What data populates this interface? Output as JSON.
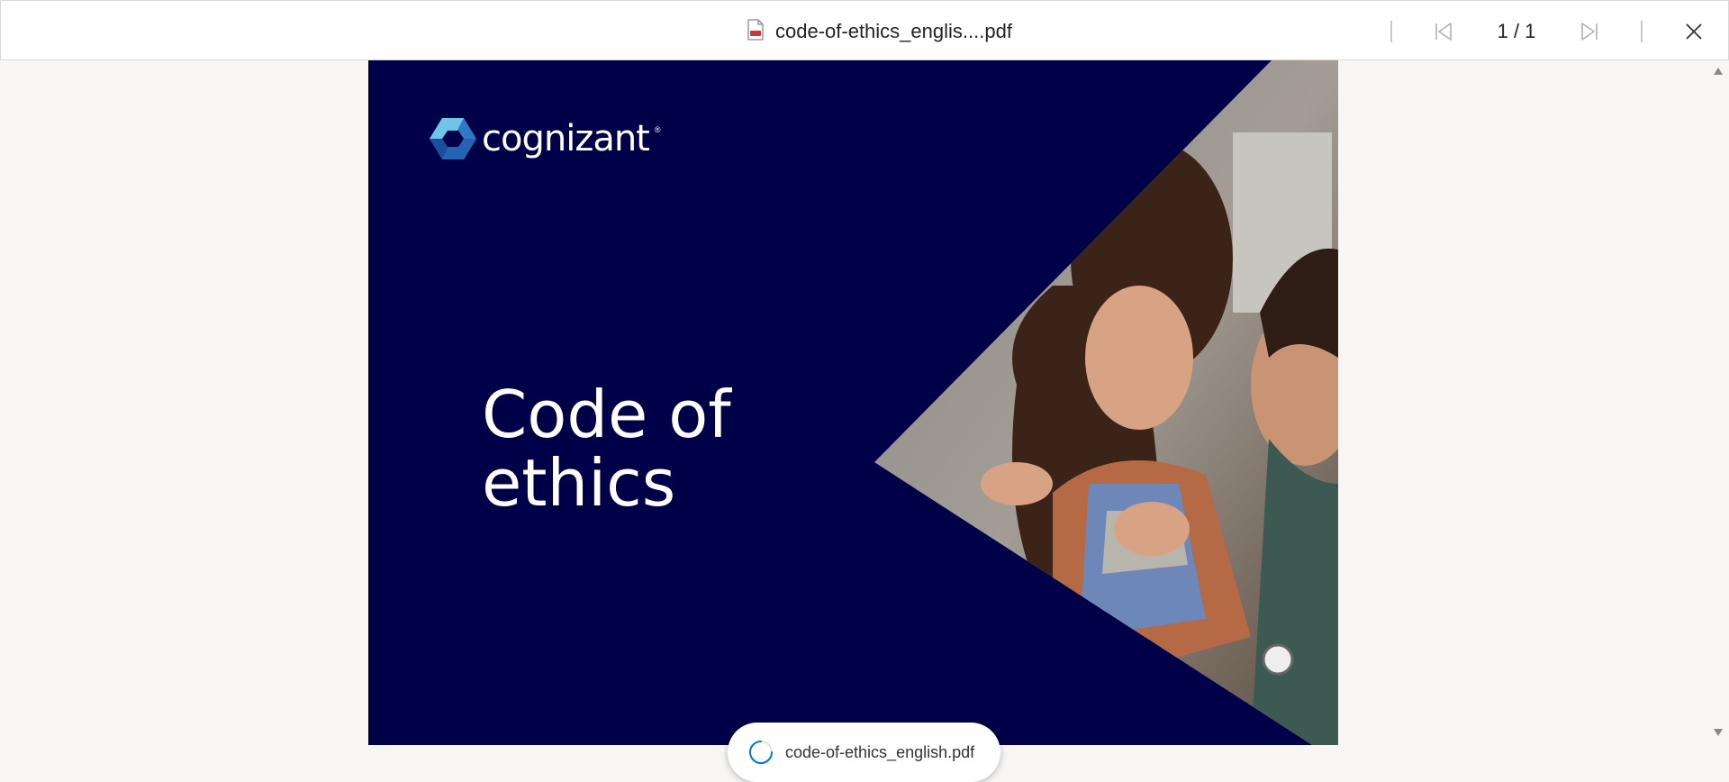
{
  "toolbar": {
    "file_title": "code-of-ethics_englis....pdf",
    "file_icon": "pdf-file-icon",
    "first_page_icon": "first-page-icon",
    "page_indicator": "1 / 1",
    "last_page_icon": "last-page-icon",
    "close_icon": "close-icon"
  },
  "document": {
    "logo_text": "cognizant",
    "logo_tm": "®",
    "headline_line1": "Code of",
    "headline_line2": "ethics",
    "background_color": "#000048"
  },
  "toast": {
    "spinner_icon": "loading-spinner-icon",
    "filename": "code-of-ethics_english.pdf"
  },
  "scrollbar": {
    "up_icon": "scroll-up-arrow-icon",
    "down_icon": "scroll-down-arrow-icon"
  },
  "colors": {
    "accent": "#0078d4",
    "page_bg": "#000048",
    "viewer_bg": "#f7f6f5"
  }
}
